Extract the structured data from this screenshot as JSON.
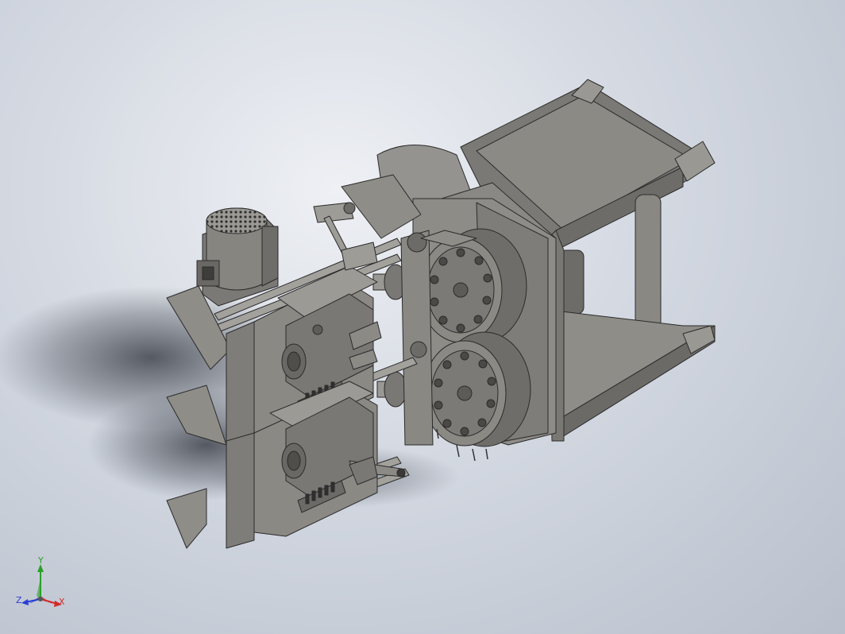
{
  "viewport": {
    "background_top": "#eef0f4",
    "background_bottom": "#b9c0cc",
    "model_color": "#8c8a85",
    "edge_color": "#2b2b2b"
  },
  "triad": {
    "x_label": "X",
    "y_label": "Y",
    "z_label": "Z",
    "x_color": "#d42a2a",
    "y_color": "#2aa02a",
    "z_color": "#2a3fd4"
  }
}
